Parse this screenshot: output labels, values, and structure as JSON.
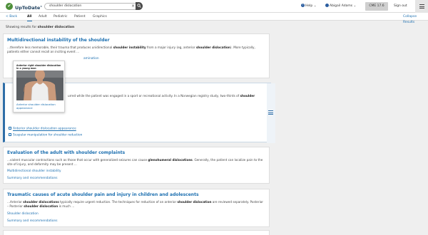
{
  "header": {
    "logo_text": "UpToDate",
    "logo_mark": "®",
    "search_value": "shoulder dislocation",
    "help_label": "Help",
    "user_name": "Abigail Adams",
    "cme_label": "CME 17.6",
    "signout_label": "Sign out",
    "icons": {
      "logo": "uptodate-logo-icon",
      "clear": "close-icon",
      "search": "search-icon",
      "menu": "hamburger-menu-icon"
    }
  },
  "subnav": {
    "back_label": "< Back",
    "tabs": [
      {
        "label": "All",
        "active": true
      },
      {
        "label": "Adult",
        "active": false
      },
      {
        "label": "Pediatric",
        "active": false
      },
      {
        "label": "Patient",
        "active": false
      },
      {
        "label": "Graphics",
        "active": false
      }
    ],
    "collapse_label": "Collapse Results"
  },
  "showing": {
    "prefix": "Showing results for",
    "query": "shoulder dislocation"
  },
  "results": [
    {
      "title": "Multidirectional instability of the shoulder",
      "snippet_1": "...therefore less memorable, their trauma that produces unidirectional ",
      "snippet_b1": "shoulder instability",
      "snippet_2": " from a major injury (eg, anterior ",
      "snippet_b2": "shoulder dislocation",
      "snippet_3": "). More typically, patients either cannot recall an inciting event ...",
      "link_partial": "amination"
    },
    {
      "snippet_a": "urred while the patient was engaged in a sport or recreational activity. In a Norwegian registry study, two-thirds of ",
      "snippet_b": "shoulder",
      "graphic_links": [
        "Anterior shoulder dislocation appearance",
        "Scapular manipulation for shoulder reduction"
      ]
    },
    {
      "title": "Evaluation of the adult with shoulder complaints",
      "snippet_1": "...violent muscular contractions such as those that occur with generalized seizures can cause ",
      "snippet_b1": "glenohumeral dislocations",
      "snippet_2": ". Generally, the patient can localize pain to the site of injury, and deformity may be present ...",
      "links": [
        "Multidirectional shoulder instability",
        "Summary and recommendations"
      ]
    },
    {
      "title": "Traumatic causes of acute shoulder pain and injury in children and adolescents",
      "snippet_1": "...Anterior ",
      "snippet_b1": "shoulder dislocations",
      "snippet_2": " typically require urgent reduction. The techniques for reduction of an anterior ",
      "snippet_b2": "shoulder dislocation",
      "snippet_3": " are reviewed separately. Posterior – Posterior ",
      "snippet_b3": "shoulder dislocation",
      "snippet_4": " is much ...",
      "links": [
        "Shoulder dislocation",
        "Summary and recommendations"
      ]
    }
  ],
  "popup": {
    "caption": "Anterior right shoulder dislocation in a young man",
    "link": "Anterior shoulder dislocation appearance"
  }
}
